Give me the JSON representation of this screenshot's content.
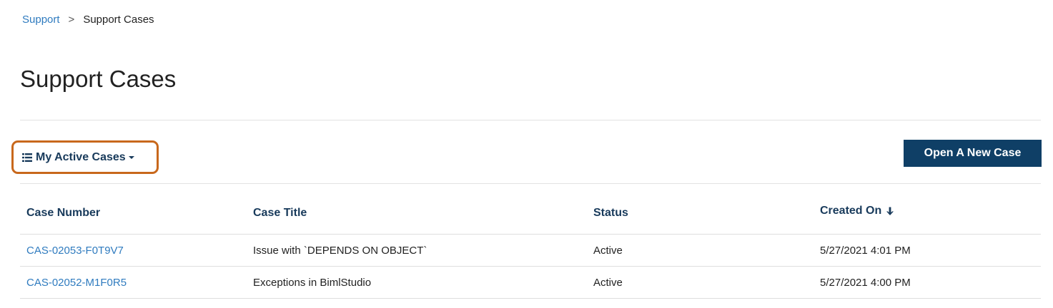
{
  "breadcrumb": {
    "parent": "Support",
    "separator": ">",
    "current": "Support Cases"
  },
  "page": {
    "title": "Support Cases"
  },
  "toolbar": {
    "view_label": "My Active Cases",
    "new_case_label": "Open A New Case"
  },
  "table": {
    "headers": {
      "case_number": "Case Number",
      "case_title": "Case Title",
      "status": "Status",
      "created_on": "Created On"
    },
    "sort": {
      "column": "created_on",
      "direction": "descending"
    },
    "rows": [
      {
        "case_number": "CAS-02053-F0T9V7",
        "case_title": "Issue with `DEPENDS ON OBJECT`",
        "status": "Active",
        "created_on": "5/27/2021 4:01 PM"
      },
      {
        "case_number": "CAS-02052-M1F0R5",
        "case_title": "Exceptions in BimlStudio",
        "status": "Active",
        "created_on": "5/27/2021 4:00 PM"
      }
    ]
  },
  "colors": {
    "link": "#2f7bbf",
    "heading": "#183a5b",
    "primary_button": "#0f3f66",
    "highlight_border": "#c8681c"
  },
  "icons": {
    "view_selector": "list-icon",
    "view_dropdown": "caret-down-icon",
    "sort": "arrow-down-icon"
  }
}
